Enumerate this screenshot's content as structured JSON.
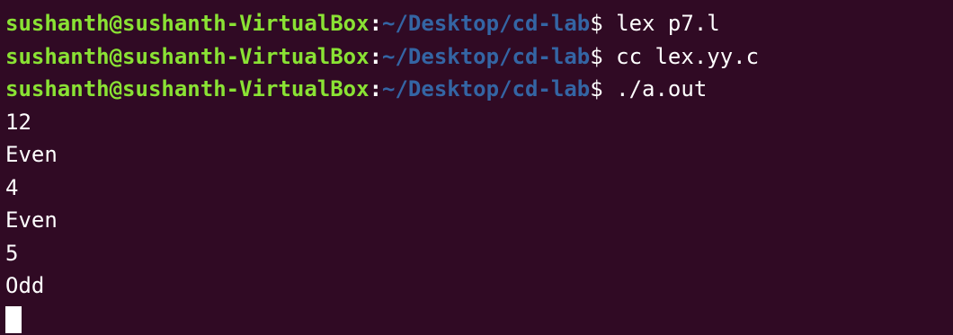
{
  "terminal": {
    "colors": {
      "background": "#300a24",
      "user": "#8ae234",
      "path": "#3465a4",
      "text": "#ffffff"
    },
    "prompt": {
      "user_host": "sushanth@sushanth-VirtualBox",
      "separator": ":",
      "path": "~/Desktop/cd-lab",
      "symbol": "$"
    },
    "commands": [
      " lex p7.l",
      " cc lex.yy.c",
      " ./a.out"
    ],
    "output": [
      "12",
      "Even",
      "4",
      "Even",
      "5",
      "Odd"
    ]
  }
}
